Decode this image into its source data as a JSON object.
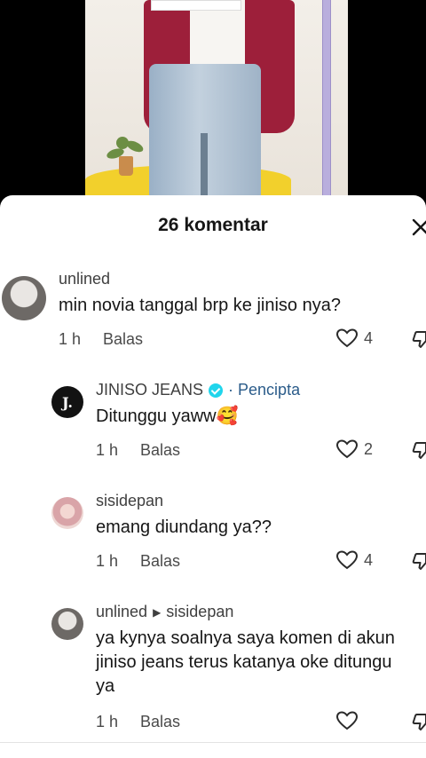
{
  "video": {
    "icons": [
      "video-frame",
      "person-figure",
      "plant-icon"
    ]
  },
  "sheet": {
    "title": "26 komentar",
    "close_icon": "close-icon"
  },
  "comments": [
    {
      "username": "unlined",
      "text": "min novia tanggal brp ke jiniso nya?",
      "time": "1 h",
      "reply_label": "Balas",
      "likes": "4"
    },
    {
      "username": "JINISO JEANS",
      "badge": "Pencipta",
      "avatar_text": "J.",
      "text": "Ditunggu yaww🥰",
      "time": "1 h",
      "reply_label": "Balas",
      "likes": "2"
    },
    {
      "username": "sisidepan",
      "text": "emang diundang ya??",
      "time": "1 h",
      "reply_label": "Balas",
      "likes": "4"
    },
    {
      "username": "unlined",
      "reply_to": "sisidepan",
      "text": "ya kynya soalnya saya komen di akun\njiniso jeans terus katanya oke ditungu\nya",
      "time": "1 h",
      "reply_label": "Balas",
      "likes": ""
    }
  ],
  "colors": {
    "creator_label": "#2b5c8a",
    "verified": "#20d5ec"
  }
}
